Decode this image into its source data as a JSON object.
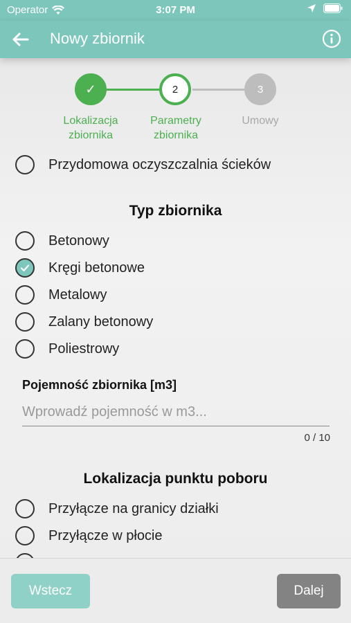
{
  "status_bar": {
    "carrier": "Operator",
    "time": "3:07 PM"
  },
  "app_bar": {
    "title": "Nowy zbiornik"
  },
  "stepper": {
    "steps": [
      {
        "number": "✓",
        "label_line1": "Lokalizacja",
        "label_line2": "zbiornika",
        "state": "done"
      },
      {
        "number": "2",
        "label_line1": "Parametry",
        "label_line2": "zbiornika",
        "state": "active"
      },
      {
        "number": "3",
        "label_line1": "Umowy",
        "label_line2": "",
        "state": "inactive"
      }
    ]
  },
  "prev_section": {
    "option": "Przydomowa oczyszczalnia ścieków"
  },
  "tank_type": {
    "title": "Typ zbiornika",
    "options": [
      "Betonowy",
      "Kręgi betonowe",
      "Metalowy",
      "Zalany betonowy",
      "Poliestrowy"
    ],
    "selected_index": 1
  },
  "capacity": {
    "label": "Pojemność zbiornika [m3]",
    "placeholder": "Wprowadź pojemność w m3...",
    "value": "",
    "counter": "0 / 10"
  },
  "pickup": {
    "title": "Lokalizacja punktu poboru",
    "options": [
      "Przyłącze na granicy działki",
      "Przyłącze w płocie"
    ]
  },
  "footer": {
    "back_label": "Wstecz",
    "next_label": "Dalej"
  },
  "colors": {
    "accent": "#7dc6bb",
    "step_done": "#4caf50",
    "step_inactive": "#bdbdbd",
    "next_button": "#838383"
  }
}
